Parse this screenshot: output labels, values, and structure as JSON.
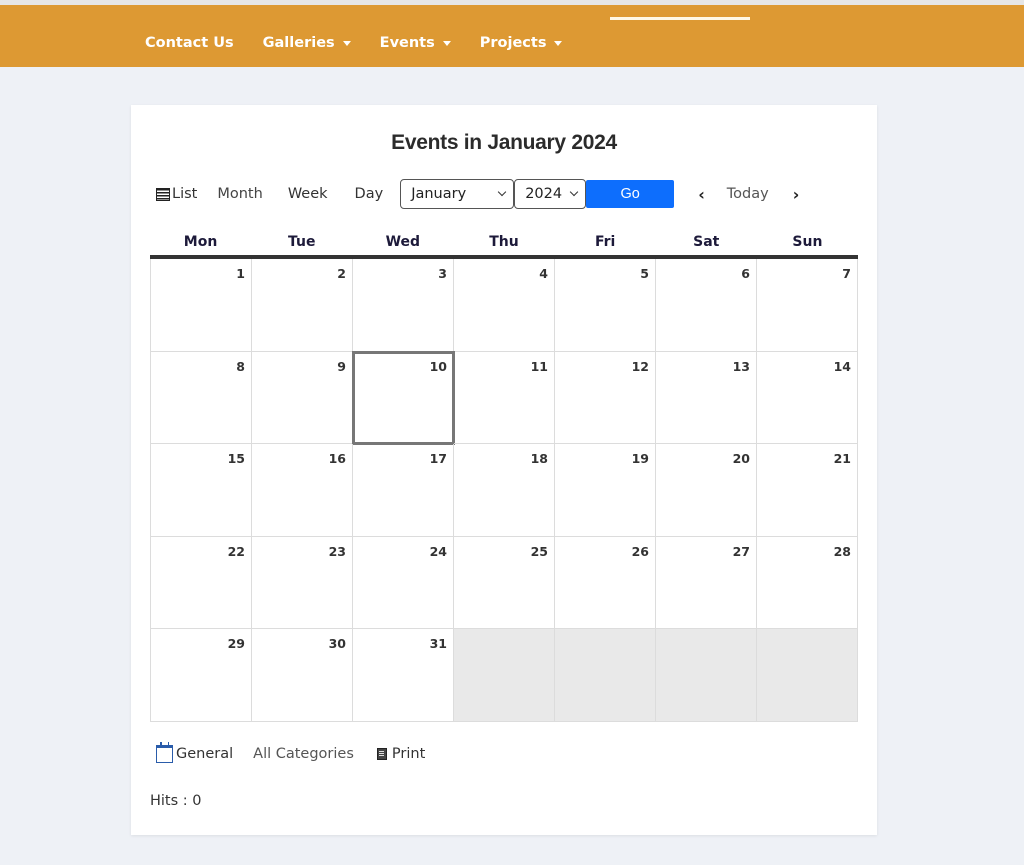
{
  "nav": {
    "items": [
      {
        "label": "Contact Us",
        "has_dropdown": false
      },
      {
        "label": "Galleries",
        "has_dropdown": true
      },
      {
        "label": "Events",
        "has_dropdown": true
      },
      {
        "label": "Projects",
        "has_dropdown": true
      }
    ],
    "brand_color": "#dd9933"
  },
  "calendar": {
    "title": "Events in January 2024",
    "views": {
      "list": "List",
      "month": "Month",
      "week": "Week",
      "day": "Day"
    },
    "month_select": "January",
    "year_select": "2024",
    "go_label": "Go",
    "prev_label": "‹",
    "today_label": "Today",
    "next_label": "›",
    "weekdays": [
      "Mon",
      "Tue",
      "Wed",
      "Thu",
      "Fri",
      "Sat",
      "Sun"
    ],
    "weeks": [
      [
        "1",
        "2",
        "3",
        "4",
        "5",
        "6",
        "7"
      ],
      [
        "8",
        "9",
        "10",
        "11",
        "12",
        "13",
        "14"
      ],
      [
        "15",
        "16",
        "17",
        "18",
        "19",
        "20",
        "21"
      ],
      [
        "22",
        "23",
        "24",
        "25",
        "26",
        "27",
        "28"
      ],
      [
        "29",
        "30",
        "31",
        "",
        "",
        "",
        ""
      ]
    ],
    "today": "10"
  },
  "footer": {
    "category_label": "General",
    "all_categories_label": "All Categories",
    "print_label": "Print",
    "hits": "Hits : 0"
  }
}
